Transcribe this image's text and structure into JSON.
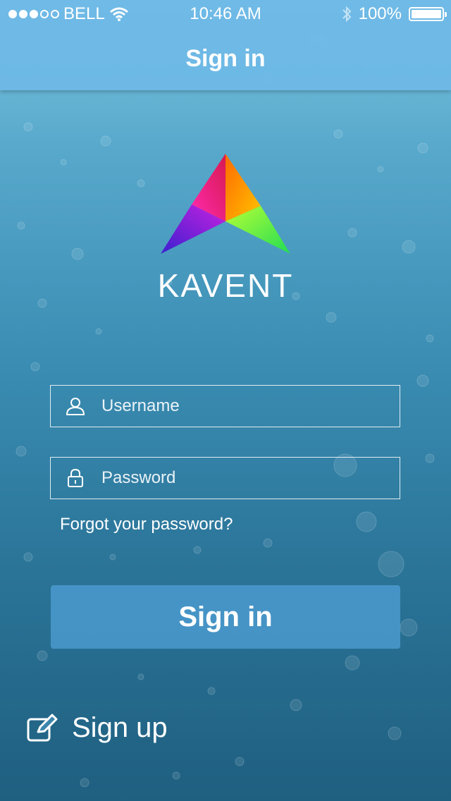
{
  "status_bar": {
    "carrier": "BELL",
    "time": "10:46 AM",
    "battery_percent": "100%",
    "signal_strength": 3,
    "signal_max": 5,
    "icons": [
      "wifi-icon",
      "bluetooth-icon",
      "battery-icon"
    ]
  },
  "nav": {
    "title": "Sign in"
  },
  "brand": {
    "name": "KAVENT"
  },
  "form": {
    "username_placeholder": "Username",
    "password_placeholder": "Password",
    "forgot_label": "Forgot your password?",
    "submit_label": "Sign in"
  },
  "signup": {
    "label": "Sign up",
    "icon": "edit-icon"
  },
  "colors": {
    "nav_bg": "#6eb9e6",
    "button_bg": "#50a0d7",
    "logo_magenta": "#e0207f",
    "logo_orange": "#ff9900",
    "logo_green": "#66ee22",
    "logo_purple": "#6a1fe0"
  }
}
